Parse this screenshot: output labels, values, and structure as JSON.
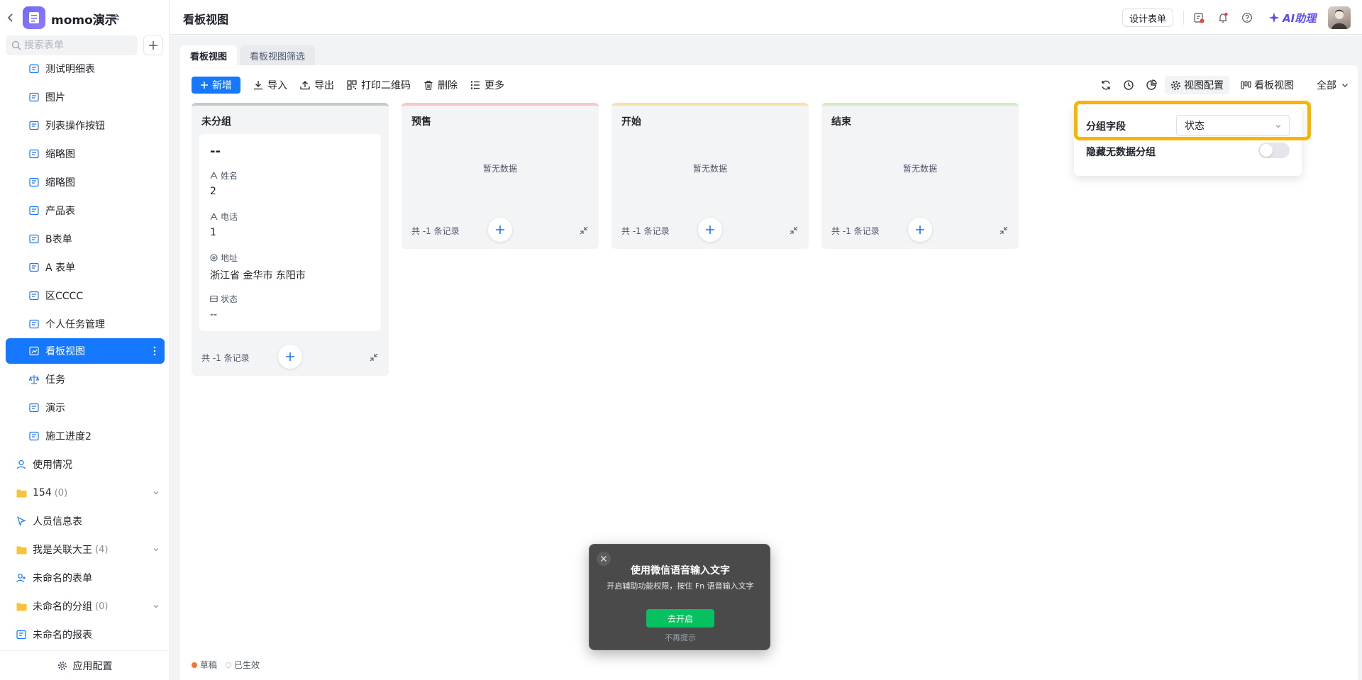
{
  "app": {
    "name": "momo演示"
  },
  "sidebar": {
    "search_placeholder": "搜索表单",
    "items": [
      {
        "label": "测试明细表",
        "icon": "form-icon"
      },
      {
        "label": "图片",
        "icon": "form-icon"
      },
      {
        "label": "列表操作按钮",
        "icon": "form-icon"
      },
      {
        "label": "缩略图",
        "icon": "form-icon"
      },
      {
        "label": "缩略图",
        "icon": "form-icon"
      },
      {
        "label": "产品表",
        "icon": "form-icon"
      },
      {
        "label": "B表单",
        "icon": "form-icon"
      },
      {
        "label": "A 表单",
        "icon": "form-icon"
      },
      {
        "label": "区CCCC",
        "icon": "form-icon"
      },
      {
        "label": "个人任务管理",
        "icon": "form-icon"
      },
      {
        "label": "看板视图",
        "icon": "kanban-icon"
      },
      {
        "label": "任务",
        "icon": "balance-icon"
      },
      {
        "label": "演示",
        "icon": "form-icon"
      },
      {
        "label": "施工进度2",
        "icon": "form-icon"
      }
    ],
    "top_items": [
      {
        "label": "使用情况",
        "icon": "user-icon"
      },
      {
        "label": "154",
        "count": "(0)",
        "icon": "folder-icon"
      },
      {
        "label": "人员信息表",
        "icon": "cursor-icon"
      },
      {
        "label": "我是关联大王",
        "count": "(4)",
        "icon": "folder-icon"
      },
      {
        "label": "未命名的表单",
        "icon": "user-add-icon"
      },
      {
        "label": "未命名的分组",
        "count": "(0)",
        "icon": "folder-icon"
      },
      {
        "label": "未命名的报表",
        "icon": "form-icon"
      }
    ],
    "footer": "应用配置"
  },
  "header": {
    "title": "看板视图",
    "design_button": "设计表单",
    "ai_label": "AI助理"
  },
  "tabs": [
    "看板视图",
    "看板视图筛选"
  ],
  "toolbar": {
    "add": "新增",
    "import": "导入",
    "export": "导出",
    "print_qr": "打印二维码",
    "delete": "删除",
    "more": "更多",
    "view_config": "视图配置",
    "kanban_view": "看板视图",
    "scope": "全部"
  },
  "columns": [
    {
      "title": "未分组",
      "color": "#c4c8cf",
      "count": "共 -1 条记录"
    },
    {
      "title": "预售",
      "color": "#f7c6c6",
      "count": "共 -1 条记录",
      "empty": "暂无数据"
    },
    {
      "title": "开始",
      "color": "#f8e2a6",
      "count": "共 -1 条记录",
      "empty": "暂无数据"
    },
    {
      "title": "结束",
      "color": "#cfeec2",
      "count": "共 -1 条记录",
      "empty": "暂无数据"
    }
  ],
  "card": {
    "title": "--",
    "fields": [
      {
        "label": "姓名",
        "value": "2"
      },
      {
        "label": "电话",
        "value": "1"
      },
      {
        "label": "地址",
        "value": "浙江省 金华市 东阳市"
      },
      {
        "label": "状态",
        "value": "--"
      }
    ]
  },
  "popover": {
    "group_field_label": "分组字段",
    "group_field_value": "状态",
    "hide_empty_label": "隐藏无数据分组",
    "hide_empty_on": false
  },
  "legend": {
    "draft": "草稿",
    "active": "已生效"
  },
  "toast": {
    "title": "使用微信语音输入文字",
    "desc": "开启辅助功能权限，按住 Fn 语音输入文字",
    "button": "去开启",
    "dismiss": "不再提示"
  }
}
